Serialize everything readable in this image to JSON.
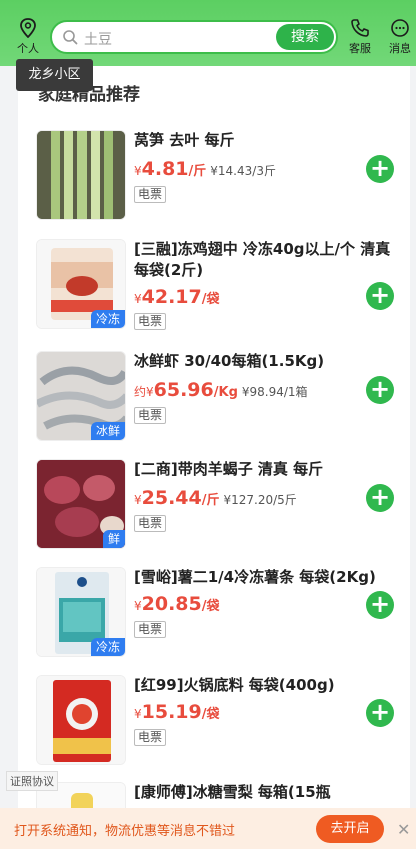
{
  "header": {
    "personal_label": "个人",
    "search_placeholder": "土豆",
    "search_button": "搜索",
    "service_label": "客服",
    "message_label": "消息"
  },
  "tooltip": {
    "location": "龙乡小区"
  },
  "section": {
    "title": "家庭精品推荐"
  },
  "products": [
    {
      "name": "莴笋 去叶 每斤",
      "price_prefix": "¥",
      "price": "4.81",
      "unit": "/斤",
      "ref": "¥14.43/3斤",
      "ticket": "电票",
      "tag": ""
    },
    {
      "name": "[三融]冻鸡翅中 冷冻40g以上/个 清真 每袋(2斤)",
      "price_prefix": "¥",
      "price": "42.17",
      "unit": "/袋",
      "ref": "",
      "ticket": "电票",
      "tag": "冷冻"
    },
    {
      "name": "冰鲜虾  30/40每箱(1.5Kg)",
      "price_prefix": "约¥",
      "price": "65.96",
      "unit": "/Kg",
      "ref": "¥98.94/1箱",
      "ticket": "电票",
      "tag": "冰鲜"
    },
    {
      "name": "[二商]带肉羊蝎子 清真 每斤",
      "price_prefix": "¥",
      "price": "25.44",
      "unit": "/斤",
      "ref": "¥127.20/5斤",
      "ticket": "电票",
      "tag": "鲜"
    },
    {
      "name": "[雪峪]薯二1/4冷冻薯条 每袋(2Kg)",
      "price_prefix": "¥",
      "price": "20.85",
      "unit": "/袋",
      "ref": "",
      "ticket": "电票",
      "tag": "冷冻"
    },
    {
      "name": "[红99]火锅底料 每袋(400g)",
      "price_prefix": "¥",
      "price": "15.19",
      "unit": "/袋",
      "ref": "",
      "ticket": "电票",
      "tag": ""
    },
    {
      "name": "[康师傅]冰糖雪梨 每箱(15瓶",
      "price_prefix": "",
      "price": "",
      "unit": "",
      "ref": "",
      "ticket": "",
      "tag": ""
    }
  ],
  "footer": {
    "license": "证照协议",
    "notify_text": "打开系统通知，物流优惠等消息不错过",
    "notify_button": "去开启",
    "close": "✕"
  }
}
